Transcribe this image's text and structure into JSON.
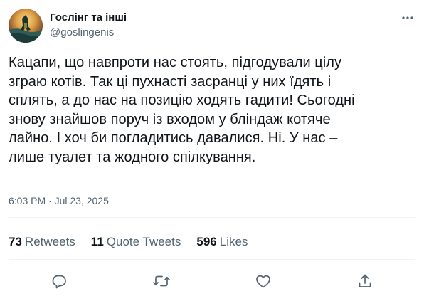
{
  "author": {
    "display_name": "Гослінг та інші",
    "handle": "@goslingenis"
  },
  "tweet": {
    "text": "Кацапи, що навпроти нас стоять, підгодували цілу\nзграю котів. Так ці пухнасті засранці у них їдять і\nсплять, а до нас на позицію ходять гадити! Сьогодні\nзнову знайшов поруч із входом у бліндаж котяче\nлайно. І хоч би погладитись давалися. Ні. У нас –\nлише туалет та жодного спілкування.",
    "time": "6:03 PM",
    "separator": "·",
    "date": "Jul 23, 2025"
  },
  "stats": {
    "retweets_count": "73",
    "retweets_label": "Retweets",
    "quotes_count": "11",
    "quotes_label": "Quote Tweets",
    "likes_count": "596",
    "likes_label": "Likes"
  },
  "icons": {
    "more": "more-horizontal-icon",
    "reply": "reply-icon",
    "retweet": "retweet-icon",
    "like": "heart-icon",
    "share": "share-icon"
  },
  "colors": {
    "text": "#0f1419",
    "secondary": "#536471",
    "divider": "#eff3f4"
  }
}
